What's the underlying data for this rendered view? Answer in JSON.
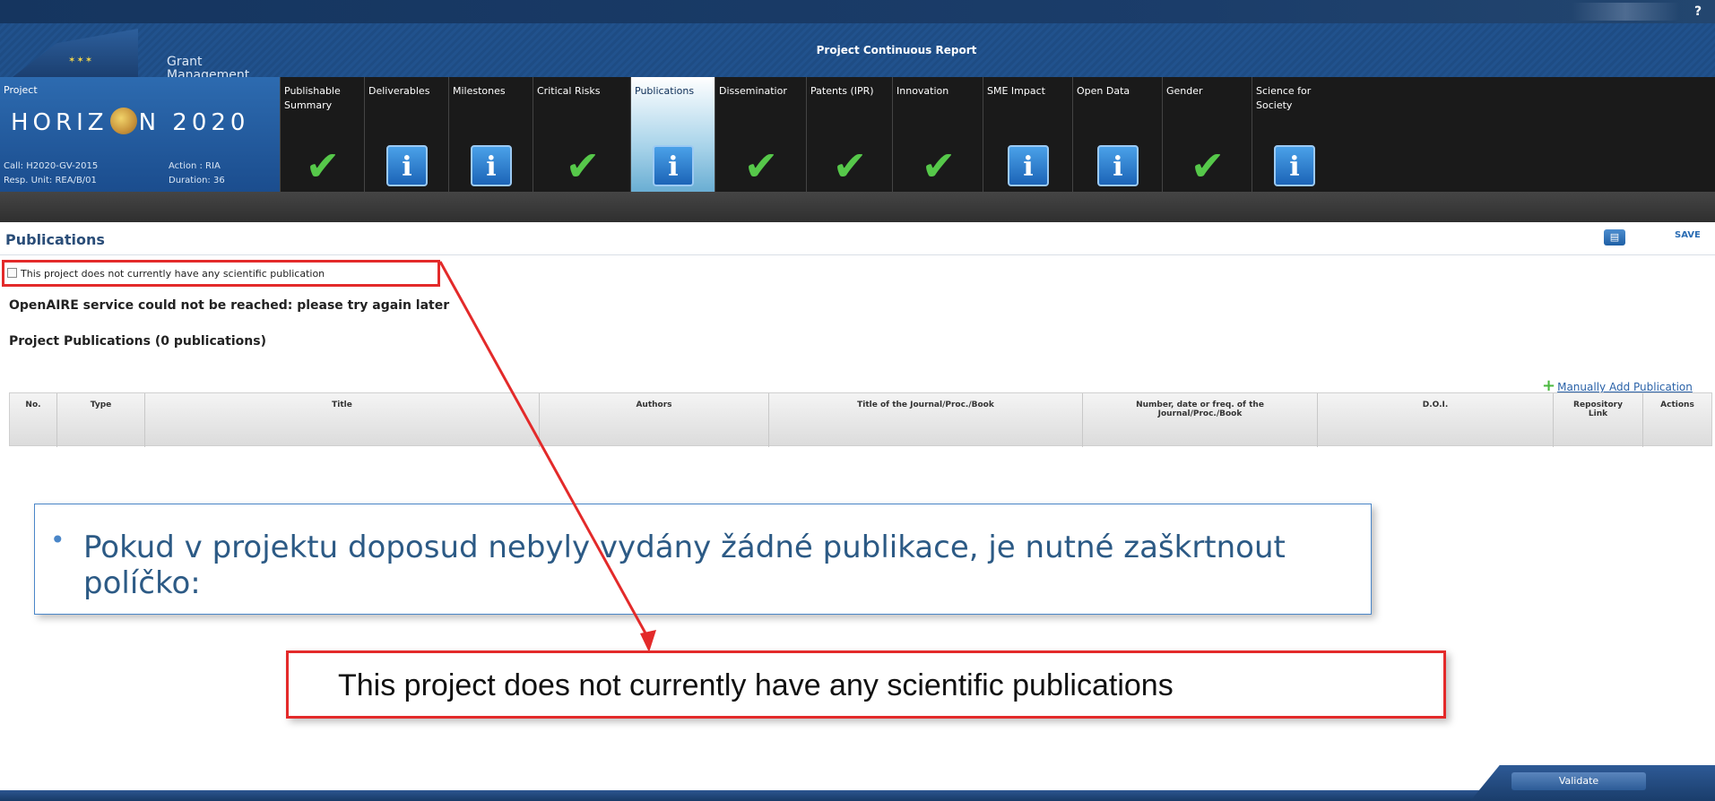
{
  "app": {
    "help_label": "?",
    "gm_line1": "Grant",
    "gm_line2": "Management",
    "report_title": "Project Continuous Report"
  },
  "project": {
    "label": "Project",
    "programme_left": "HORIZ",
    "programme_right": "N 2020",
    "call": "Call: H2020-GV-2015",
    "action": "Action : RIA",
    "unit": "Resp. Unit: REA/B/01",
    "duration": "Duration: 36"
  },
  "tabs": [
    {
      "label": "Publishable Summary",
      "status": "check"
    },
    {
      "label": "Deliverables",
      "status": "info"
    },
    {
      "label": "Milestones",
      "status": "info"
    },
    {
      "label": "Critical Risks",
      "status": "check"
    },
    {
      "label": "Publications",
      "status": "info",
      "active": true
    },
    {
      "label": "Disseminatior",
      "status": "check"
    },
    {
      "label": "Patents (IPR)",
      "status": "check"
    },
    {
      "label": "Innovation",
      "status": "check"
    },
    {
      "label": "SME Impact",
      "status": "info"
    },
    {
      "label": "Open Data",
      "status": "info"
    },
    {
      "label": "Gender",
      "status": "check"
    },
    {
      "label": "Science for Society",
      "status": "info"
    }
  ],
  "page": {
    "title": "Publications",
    "save_label": "SAVE",
    "checkbox_label": "This project does not currently have any scientific publication",
    "openaire_msg": "OpenAIRE service could not be reached: please try again later",
    "pub_count": "Project Publications (0 publications)",
    "add_label": "Manually Add Publication"
  },
  "table": {
    "headers": [
      "No.",
      "Type",
      "Title",
      "Authors",
      "Title of the Journal/Proc./Book",
      "Number, date or freq. of the Journal/Proc./Book",
      "D.O.I.",
      "Repository Link",
      "Actions"
    ]
  },
  "callout": {
    "text": "Pokud v projektu doposud nebyly vydány žádné publikace, je nutné zaškrtnout políčko:",
    "label_box": "This project  does not currently have any scientific publications"
  },
  "footer": {
    "validate_label": "Validate"
  },
  "colors": {
    "highlight_red": "#e32a2a",
    "callout_blue": "#4a86c8",
    "check_green": "#56c84a",
    "info_blue": "#1c64b7"
  }
}
